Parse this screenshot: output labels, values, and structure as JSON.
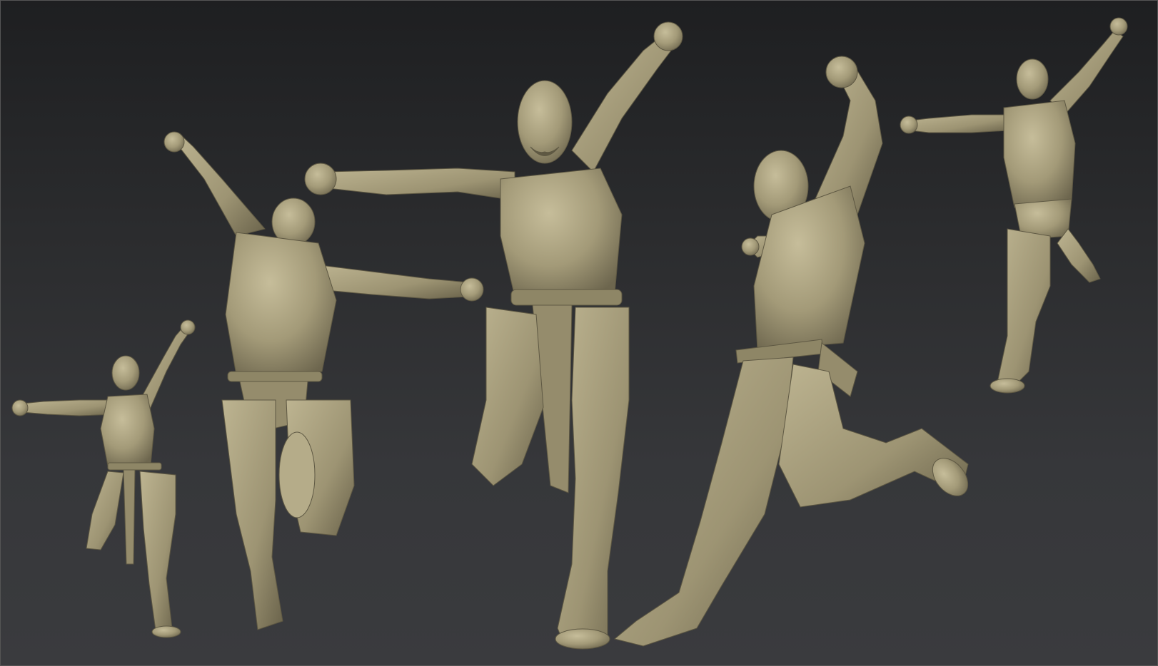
{
  "scene": {
    "background_top": "#1e1f21",
    "background_bottom": "#3a3b3e",
    "clay_color": "#a39a78",
    "clay_shadow": "#6f6850",
    "clay_highlight": "#c4bb98",
    "figures": [
      {
        "pose": "front-jump-small"
      },
      {
        "pose": "back-view-jump"
      },
      {
        "pose": "front-jump-center"
      },
      {
        "pose": "side-view-kick"
      },
      {
        "pose": "front-jump-nude-small"
      }
    ]
  }
}
